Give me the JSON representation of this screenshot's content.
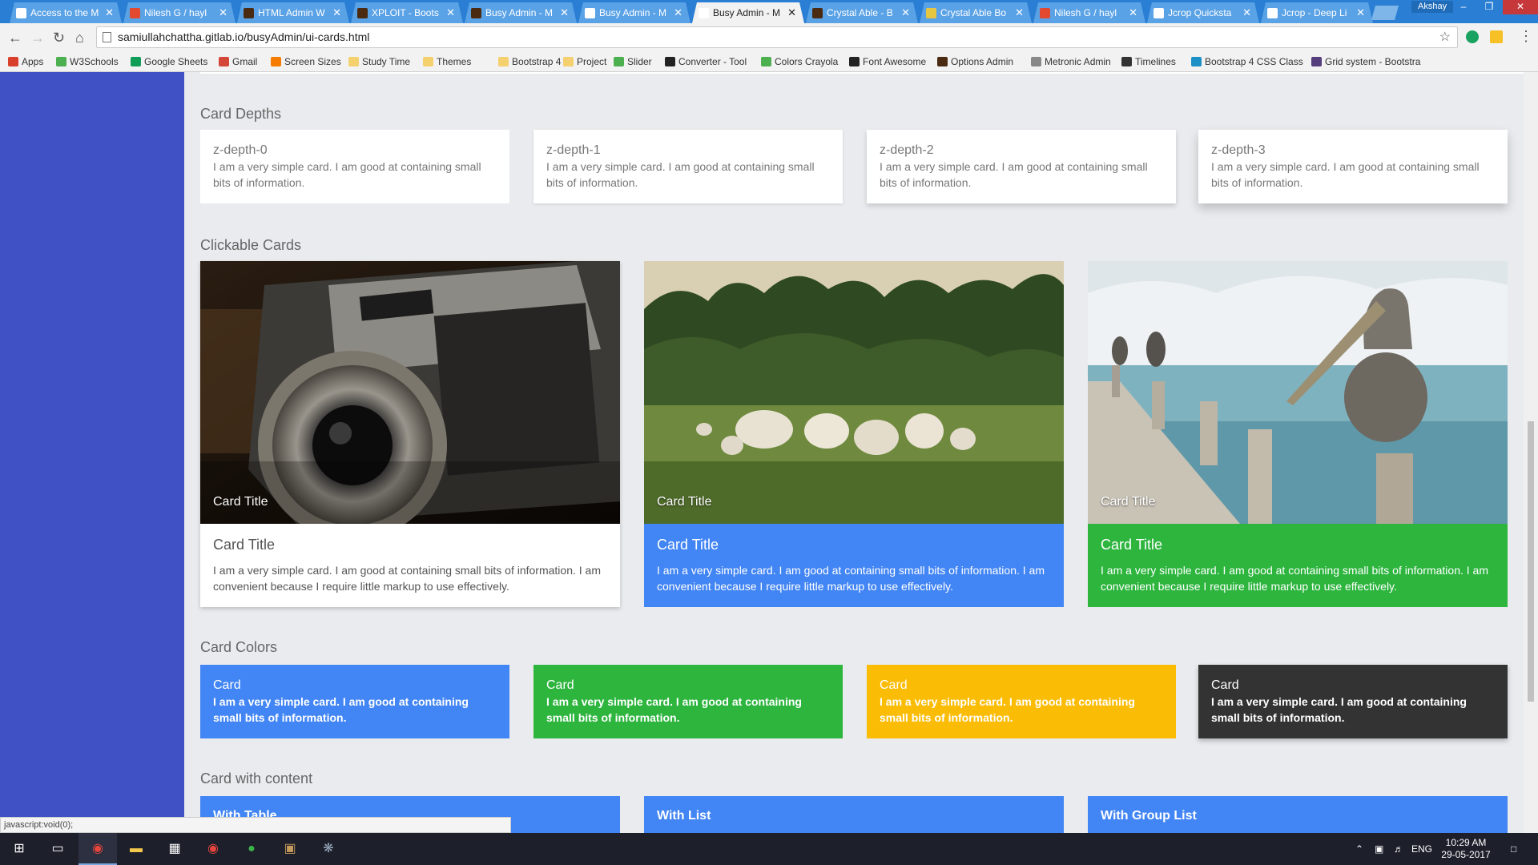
{
  "browser": {
    "tabs": [
      {
        "title": "Access to the M",
        "color": "#ffffff",
        "active": false
      },
      {
        "title": "Nilesh G / hayl",
        "color": "#e2492f",
        "active": false
      },
      {
        "title": "HTML Admin W",
        "color": "#4a2a10",
        "active": false
      },
      {
        "title": "XPLOIT - Boots",
        "color": "#4a2a10",
        "active": false
      },
      {
        "title": "Busy Admin - M",
        "color": "#4a2a10",
        "active": false
      },
      {
        "title": "Busy Admin - M",
        "color": "#ffffff",
        "active": false
      },
      {
        "title": "Busy Admin - M",
        "color": "#ffffff",
        "active": true
      },
      {
        "title": "Crystal Able - B",
        "color": "#4a2a10",
        "active": false
      },
      {
        "title": "Crystal Able Bo",
        "color": "#e5c643",
        "active": false
      },
      {
        "title": "Nilesh G / hayl",
        "color": "#e2492f",
        "active": false
      },
      {
        "title": "Jcrop Quicksta",
        "color": "#ffffff",
        "active": false
      },
      {
        "title": "Jcrop - Deep Li",
        "color": "#ffffff",
        "active": false
      }
    ],
    "profile_name": "Akshay",
    "url": "samiullahchattha.gitlab.io/busyAdmin/ui-cards.html",
    "bookmarks": [
      {
        "label": "Apps",
        "color": "#d9402b"
      },
      {
        "label": "W3Schools",
        "color": "#4caf50"
      },
      {
        "label": "Google Sheets",
        "color": "#0f9d58"
      },
      {
        "label": "Gmail",
        "color": "#d44638"
      },
      {
        "label": "Screen Sizes",
        "color": "#f57c00"
      },
      {
        "label": "Study Time",
        "color": "#f4d06f"
      },
      {
        "label": "Themes",
        "color": "#f4d06f"
      },
      {
        "label": "Bootstrap 4",
        "color": "#f4d06f"
      },
      {
        "label": "Project",
        "color": "#f4d06f"
      },
      {
        "label": "Slider",
        "color": "#4caf50"
      },
      {
        "label": "Converter - Tool",
        "color": "#222222"
      },
      {
        "label": "Colors Crayola",
        "color": "#4caf50"
      },
      {
        "label": "Font Awesome",
        "color": "#222222"
      },
      {
        "label": "Options Admin",
        "color": "#4a2a10"
      },
      {
        "label": "Metronic Admin",
        "color": "#888888"
      },
      {
        "label": "Timelines",
        "color": "#333333"
      },
      {
        "label": "Bootstrap 4 CSS Class",
        "color": "#1c8fc7"
      },
      {
        "label": "Grid system - Bootstra",
        "color": "#563d7c"
      }
    ],
    "status_text": "javascript:void(0);"
  },
  "page": {
    "sections": {
      "depths_title": "Card Depths",
      "clickable_title": "Clickable Cards",
      "colors_title": "Card Colors",
      "content_title": "Card with content"
    },
    "depth_cards": [
      {
        "title": "z-depth-0",
        "text": "I am a very simple card. I am good at containing small bits of information."
      },
      {
        "title": "z-depth-1",
        "text": "I am a very simple card. I am good at containing small bits of information."
      },
      {
        "title": "z-depth-2",
        "text": "I am a very simple card. I am good at containing small bits of information."
      },
      {
        "title": "z-depth-3",
        "text": "I am a very simple card. I am good at containing small bits of information."
      }
    ],
    "clickable_cards": [
      {
        "image_title": "Card Title",
        "title": "Card Title",
        "text": "I am a very simple card. I am good at containing small bits of information. I am convenient because I require little markup to use effectively.",
        "bg": "#ffffff",
        "fg": "#555555",
        "image": "camera"
      },
      {
        "image_title": "Card Title",
        "title": "Card Title",
        "text": "I am a very simple card. I am good at containing small bits of information. I am convenient because I require little markup to use effectively.",
        "bg": "#4285f4",
        "fg": "#ffffff",
        "image": "sheep"
      },
      {
        "image_title": "Card Title",
        "title": "Card Title",
        "text": "I am a very simple card. I am good at containing small bits of information. I am convenient because I require little markup to use effectively.",
        "bg": "#2db53e",
        "fg": "#ffffff",
        "image": "pelican"
      }
    ],
    "color_cards": [
      {
        "title": "Card",
        "text": "I am a very simple card. I am good at containing small bits of information.",
        "bg": "#4285f4"
      },
      {
        "title": "Card",
        "text": "I am a very simple card. I am good at containing small bits of information.",
        "bg": "#2db53e"
      },
      {
        "title": "Card",
        "text": "I am a very simple card. I am good at containing small bits of information.",
        "bg": "#fbbc05"
      },
      {
        "title": "Card",
        "text": "I am a very simple card. I am good at containing small bits of information.",
        "bg": "#333333"
      }
    ],
    "content_cards": [
      {
        "title": "With Table"
      },
      {
        "title": "With List"
      },
      {
        "title": "With Group List"
      }
    ]
  },
  "taskbar": {
    "language": "ENG",
    "time": "10:29 AM",
    "date": "29-05-2017"
  }
}
